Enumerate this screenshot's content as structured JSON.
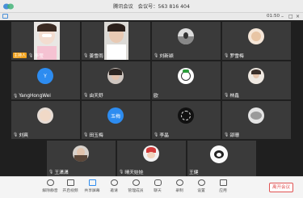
{
  "window": {
    "meeting_label": "腾讯会议",
    "meeting_id_label": "会议号：563 816 404",
    "time": "01:50"
  },
  "participants": [
    {
      "name": "李莹",
      "host_badge": "主持人",
      "type": "video"
    },
    {
      "name": "姜雪雨",
      "type": "video"
    },
    {
      "name": "刘新颖",
      "type": "avatar"
    },
    {
      "name": "罗雪梅",
      "type": "avatar"
    },
    {
      "name": "YangHongWei",
      "type": "letter",
      "initial": "Y"
    },
    {
      "name": "由天舒",
      "type": "avatar"
    },
    {
      "name": "欧",
      "type": "avatar"
    },
    {
      "name": "林鑫",
      "type": "avatar"
    },
    {
      "name": "刘爽",
      "type": "avatar"
    },
    {
      "name": "田玉梅",
      "type": "letter",
      "initial": "玉梅"
    },
    {
      "name": "李晶",
      "type": "avatar"
    },
    {
      "name": "邵珊",
      "type": "avatar"
    },
    {
      "name": "王潇潇",
      "type": "avatar"
    },
    {
      "name": "晴天娃娃",
      "type": "avatar"
    },
    {
      "name": "王健",
      "type": "avatar"
    }
  ],
  "toolbar": {
    "items": [
      "解除静音",
      "开启视频",
      "共享屏幕",
      "邀请",
      "管理成员",
      "聊天",
      "录制",
      "设置",
      "应用"
    ],
    "leave_label": "离开会议"
  },
  "colors": {
    "accent": "#2d8cf0",
    "host_badge": "#f0a01a",
    "leave": "#e05252"
  }
}
